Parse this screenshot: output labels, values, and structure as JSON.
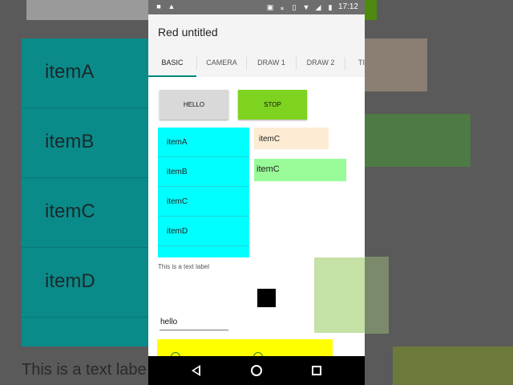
{
  "status_bar": {
    "time": "17:12",
    "left_icons": [
      "video-icon",
      "android-icon"
    ],
    "right_icons": [
      "cast-icon",
      "bluetooth-icon",
      "vibrate-icon",
      "wifi-icon",
      "signal-icon",
      "battery-icon"
    ]
  },
  "app": {
    "title": "Red untitled"
  },
  "tabs": [
    {
      "label": "BASIC",
      "active": true
    },
    {
      "label": "CAMERA",
      "active": false
    },
    {
      "label": "DRAW 1",
      "active": false
    },
    {
      "label": "DRAW 2",
      "active": false
    },
    {
      "label": "TI",
      "active": false
    }
  ],
  "buttons": {
    "hello": "HELLO",
    "stop": "STOP"
  },
  "list": {
    "items": [
      "itemA",
      "itemB",
      "itemC",
      "itemD"
    ]
  },
  "chips": {
    "beige": "itemC",
    "green": "itemC"
  },
  "text_label": "This is a text label",
  "edit_field": {
    "value": "hello"
  },
  "background": {
    "items": [
      "itemA",
      "itemB",
      "itemC",
      "itemD"
    ],
    "label": "This is a text labe"
  },
  "colors": {
    "accent": "#00897b",
    "list_bg": "#00ffff",
    "stop_button": "#7ed321",
    "chip_beige": "#fdebd3",
    "chip_green": "#98fb98",
    "yellow_panel": "#ffff00"
  }
}
